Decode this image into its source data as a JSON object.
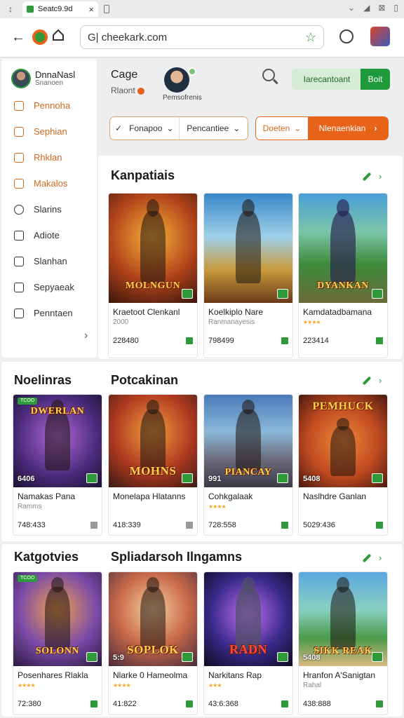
{
  "status": {
    "left_glyph": "↕",
    "tab_title": "Seatc9.9d",
    "tab_close": "×",
    "right_icons": [
      "⌄",
      "◢",
      "⊠",
      "▯"
    ]
  },
  "toolbar": {
    "url": "G| cheekark.com",
    "star": "☆",
    "back": "←"
  },
  "sidebar": {
    "user_name": "DnnaNasl",
    "user_sub": "Snanoen",
    "items": [
      {
        "label": "Pennoha",
        "accent": true
      },
      {
        "label": "Sephian",
        "accent": true
      },
      {
        "label": "Rhklan",
        "accent": true
      },
      {
        "label": "Makalos",
        "accent": true
      },
      {
        "label": "Slarins",
        "accent": false
      },
      {
        "label": "Adiote",
        "accent": false
      },
      {
        "label": "Slanhan",
        "accent": false
      },
      {
        "label": "Sepyaeak",
        "accent": false
      },
      {
        "label": "Penntaen",
        "accent": false
      }
    ],
    "chevron": "›"
  },
  "header": {
    "title": "Cage",
    "subtitle": "Rlaont",
    "avatar_label": "Pemsofrenis",
    "button_primary": "Iarecantoant",
    "button_secondary": "Boit"
  },
  "filters": {
    "check": "✓",
    "first": "Fonapoo",
    "second": "Pencantiee",
    "caret": "⌄",
    "sort_left": "Doeten",
    "sort_right": "Nlenaenkian",
    "arrow": "›"
  },
  "sections": [
    {
      "title": "Kanpatiais"
    },
    {
      "title": "Noelinras"
    },
    {
      "title": "Potcakinan"
    },
    {
      "title": "Katgotvies"
    },
    {
      "title": "Spliadarsoh Ilngamns"
    }
  ],
  "cards": [
    {
      "title": "Kraetoot Clenkanl",
      "sub": "2000",
      "stars": "",
      "count": "228480",
      "logo": "MOLNGUN",
      "num": "",
      "tag": ""
    },
    {
      "title": "Koelkiplo Nare",
      "sub": "Ranmanayesis",
      "stars": "",
      "count": "798499",
      "logo": "",
      "num": "",
      "tag": ""
    },
    {
      "title": "Kamdatadbamana",
      "sub": "",
      "stars": "★★★★",
      "count": "223414",
      "logo": "DYANKAN",
      "num": "",
      "tag": ""
    },
    {
      "title": "Namakas Pana",
      "sub": "Ramms",
      "stars": "",
      "count": "748:433",
      "logo": "DWERLAN",
      "num": "6406",
      "tag": "TCOO"
    },
    {
      "title": "Monelapa Hlatanns",
      "sub": "",
      "stars": "",
      "count": "418:339",
      "logo": "MOHNS",
      "num": "",
      "tag": ""
    },
    {
      "title": "Cohkgalaak",
      "sub": "",
      "stars": "★★★★",
      "count": "728:558",
      "logo": "PIANCAY",
      "num": "991",
      "tag": ""
    },
    {
      "title": "Naslhdre Ganlan",
      "sub": "",
      "stars": "",
      "count": "5029:436",
      "logo": "PEMHUCK",
      "num": "5408",
      "tag": ""
    },
    {
      "title": "Posenhares Rlakla",
      "sub": "",
      "stars": "★★★★",
      "count": "72:380",
      "logo": "SOLONN",
      "num": "",
      "tag": "TCOO"
    },
    {
      "title": "Nlarke 0 Hameolma",
      "sub": "",
      "stars": "★★★★",
      "count": "41:822",
      "logo": "SOPLOK",
      "num": "5:9",
      "tag": ""
    },
    {
      "title": "Narkitans Rap",
      "sub": "",
      "stars": "★★★",
      "count": "43:6:368",
      "logo": "RADN",
      "num": "",
      "tag": ""
    },
    {
      "title": "Hranfon A'Sanigtan",
      "sub": "Rahal",
      "stars": "",
      "count": "438:888",
      "logo": "SIKK REAK",
      "num": "5408",
      "tag": ""
    }
  ],
  "colors": {
    "accent_green": "#2e9a3a",
    "accent_orange": "#e8631a"
  }
}
